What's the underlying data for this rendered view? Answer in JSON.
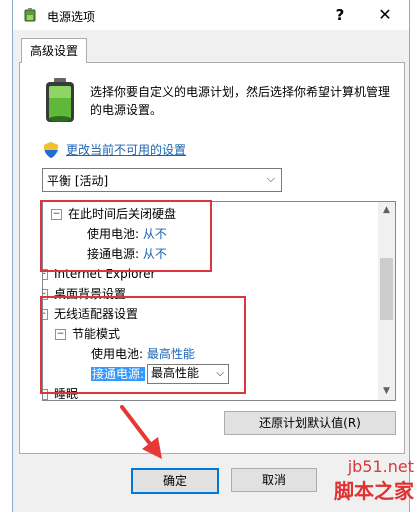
{
  "window": {
    "title": "电源选项",
    "help_label": "?",
    "close_label": "✕"
  },
  "tab": {
    "label": "高级设置"
  },
  "description": "选择你要自定义的电源计划，然后选择你希望计算机管理的电源设置。",
  "change_link": "更改当前不可用的设置",
  "plan_select": {
    "value": "平衡 [活动]"
  },
  "tree": {
    "hdd_off": {
      "label": "在此时间后关闭硬盘",
      "expander": "⊟"
    },
    "hdd_battery": {
      "label": "使用电池:",
      "value": "从不"
    },
    "hdd_plugged": {
      "label": "接通电源:",
      "value": "从不"
    },
    "ie": {
      "label": "Internet Explorer",
      "expander": "⊞"
    },
    "desktop_bg": {
      "label": "桌面背景设置",
      "expander": "⊞"
    },
    "wireless": {
      "label": "无线适配器设置",
      "expander": "⊟"
    },
    "power_save": {
      "label": "节能模式",
      "expander": "⊟"
    },
    "ps_battery": {
      "label": "使用电池:",
      "value": "最高性能"
    },
    "ps_plugged": {
      "label": "接通电源:",
      "value": "最高性能"
    },
    "sleep": {
      "label": "睡眠",
      "expander": "⊞"
    }
  },
  "restore_button": "还原计划默认值(R)",
  "ok_button": "确定",
  "cancel_button": "取消",
  "watermark": {
    "line1": "jb51.net",
    "line2": "脚本之家"
  },
  "colors": {
    "accent": "#0078d7",
    "link": "#1a64b4",
    "annotation_red": "#d9363e"
  }
}
